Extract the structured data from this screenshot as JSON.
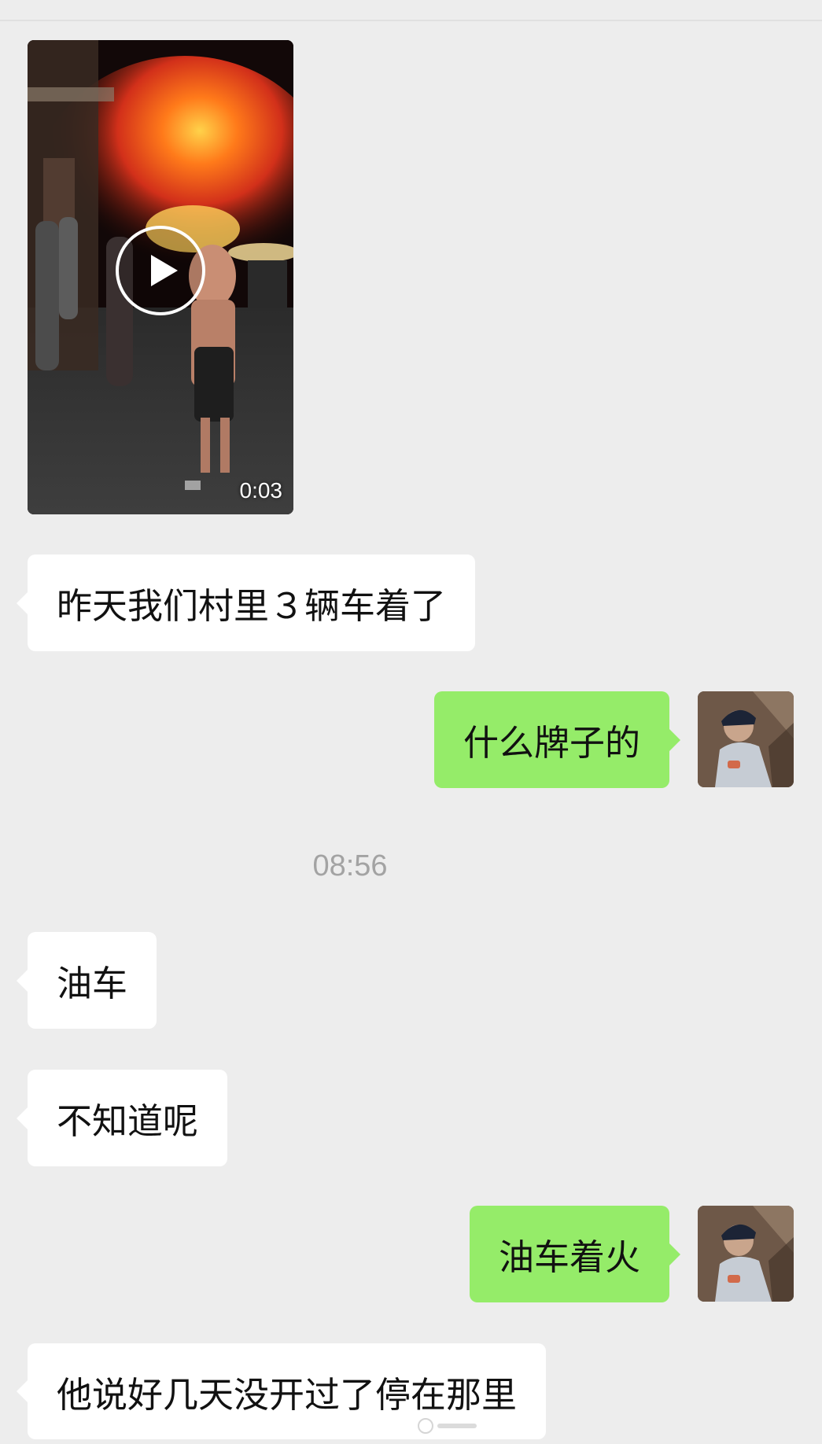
{
  "video": {
    "duration": "0:03"
  },
  "messages": [
    {
      "side": "left",
      "text": "昨天我们村里３辆车着了"
    },
    {
      "side": "right",
      "text": "什么牌子的"
    },
    {
      "side": "left",
      "text": "油车"
    },
    {
      "side": "left",
      "text": "不知道呢"
    },
    {
      "side": "right",
      "text": "油车着火"
    },
    {
      "side": "left",
      "text": "他说好几天没开过了停在那里"
    }
  ],
  "timestamp": "08:56",
  "colors": {
    "background": "#ededed",
    "incoming_bubble": "#ffffff",
    "outgoing_bubble": "#95ec69",
    "timestamp_text": "#a3a3a3"
  }
}
